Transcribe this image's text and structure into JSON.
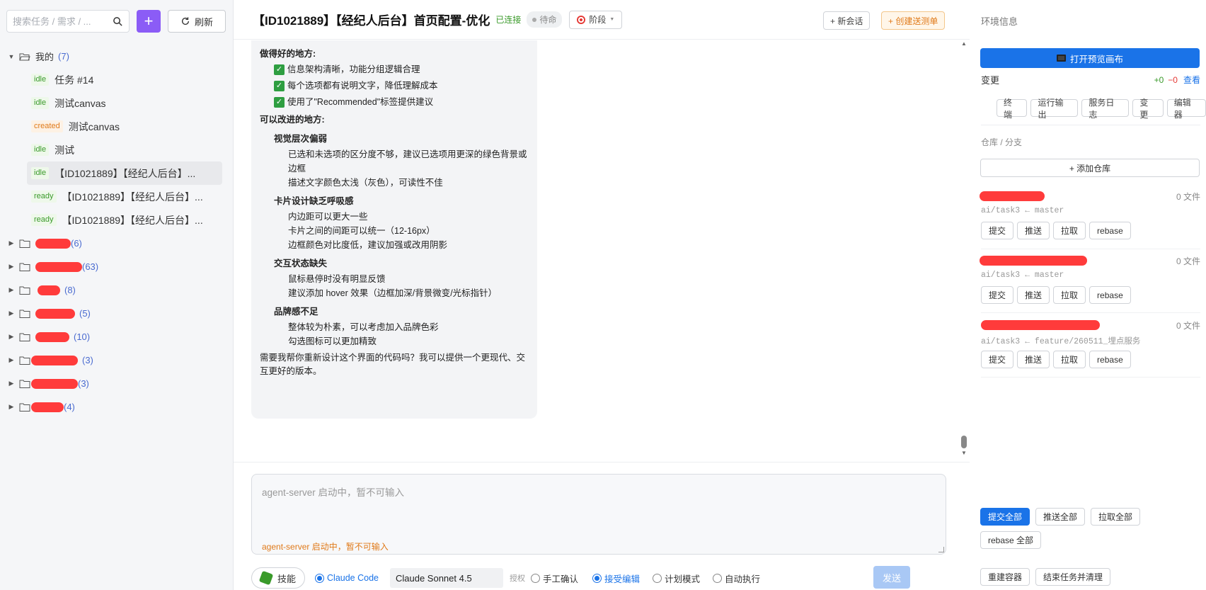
{
  "sidebar": {
    "search_placeholder": "搜索任务 / 需求 / ...",
    "refresh_label": "刷新",
    "add_label": "+",
    "mine": {
      "label": "我的",
      "count": "(7)"
    },
    "tasks": [
      {
        "status": "idle",
        "title": "任务 #14"
      },
      {
        "status": "idle",
        "title": "测试canvas"
      },
      {
        "status": "created",
        "title": "测试canvas"
      },
      {
        "status": "idle",
        "title": "测试"
      },
      {
        "status": "idle",
        "title": "【ID1021889】【经纪人后台】..."
      },
      {
        "status": "ready",
        "title": "【ID1021889】【经纪人后台】..."
      },
      {
        "status": "ready",
        "title": "【ID1021889】【经纪人后台】..."
      }
    ],
    "groups": [
      {
        "count": "(6)"
      },
      {
        "count": "(63)"
      },
      {
        "count": "(8)"
      },
      {
        "count": "(5)"
      },
      {
        "count": "(10)"
      },
      {
        "count": "(3)"
      },
      {
        "count": "(3)"
      },
      {
        "count": "(4)"
      }
    ]
  },
  "header": {
    "title": "【ID1021889】【经纪人后台】首页配置-优化",
    "connected": "已连接",
    "pending": "待命",
    "stage": "阶段",
    "new_session": "+ 新会话",
    "create_test": "+ 创建送测单"
  },
  "message": {
    "good_heading": "做得好的地方:",
    "good_items": [
      "信息架构清晰，功能分组逻辑合理",
      "每个选项都有说明文字，降低理解成本",
      "使用了\"Recommended\"标签提供建议"
    ],
    "improve_heading": "可以改进的地方:",
    "sections": [
      {
        "title": "视觉层次偏弱",
        "items": [
          "已选和未选项的区分度不够，建议已选项用更深的绿色背景或边框",
          "描述文字颜色太浅（灰色），可读性不佳"
        ]
      },
      {
        "title": "卡片设计缺乏呼吸感",
        "items": [
          "内边距可以更大一些",
          "卡片之间的间距可以统一（12-16px）",
          "边框颜色对比度低，建议加强或改用阴影"
        ]
      },
      {
        "title": "交互状态缺失",
        "items": [
          "鼠标悬停时没有明显反馈",
          "建议添加 hover 效果（边框加深/背景微变/光标指针）"
        ]
      },
      {
        "title": "品牌感不足",
        "items": [
          "整体较为朴素，可以考虑加入品牌色彩",
          "勾选图标可以更加精致"
        ]
      }
    ],
    "closing": "需要我帮你重新设计这个界面的代码吗？我可以提供一个更现代、交互更好的版本。"
  },
  "composer": {
    "placeholder": "agent-server 启动中，暂不可输入",
    "warning": "agent-server 启动中，暂不可输入",
    "skill": "技能",
    "agent": "Claude Code",
    "model": "Claude Sonnet 4.5",
    "auth_label": "授权",
    "modes": [
      "手工确认",
      "接受编辑",
      "计划模式",
      "自动执行"
    ],
    "send": "发送"
  },
  "right": {
    "env_title": "环境信息",
    "open_preview": "打开预览画布",
    "changes_label": "变更",
    "plus": "+0",
    "minus": "−0",
    "view": "查看",
    "tabs": [
      "终端",
      "运行输出",
      "服务日志",
      "变更",
      "编辑器"
    ],
    "repo_label": "仓库 / 分支",
    "add_repo": "+ 添加仓库",
    "repos": [
      {
        "files": "0 文件",
        "branch": "ai/task3 ← master"
      },
      {
        "files": "0 文件",
        "branch": "ai/task3 ← master"
      },
      {
        "files": "0 文件",
        "branch": "ai/task3 ← feature/260511_埋点服务"
      }
    ],
    "repo_actions": [
      "提交",
      "推送",
      "拉取",
      "rebase"
    ],
    "bulk": [
      "提交全部",
      "推送全部",
      "拉取全部",
      "rebase 全部"
    ],
    "rebuild": "重建容器",
    "finish": "结束任务并清理"
  },
  "colors": {
    "accent": "#1a73e8",
    "purple": "#8b5cf6",
    "redaction": "#ff3b3b"
  }
}
